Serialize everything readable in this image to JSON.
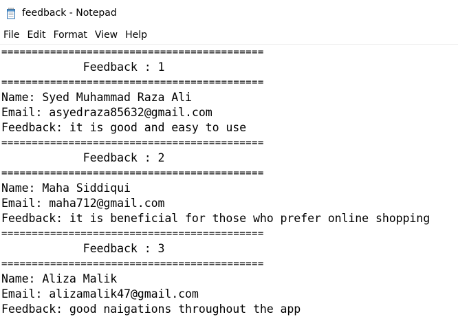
{
  "window": {
    "title": "feedback - Notepad",
    "icon": "notepad-icon"
  },
  "menu": [
    "File",
    "Edit",
    "Format",
    "View",
    "Help"
  ],
  "separator": "===========================================",
  "lines": [
    {
      "type": "sep"
    },
    {
      "type": "text",
      "text": "            Feedback : 1"
    },
    {
      "type": "sep"
    },
    {
      "type": "text",
      "text": "Name: Syed Muhammad Raza Ali"
    },
    {
      "type": "text",
      "text": "Email: asyedraza85632@gmail.com"
    },
    {
      "type": "text",
      "text": "Feedback: it is good and easy to use"
    },
    {
      "type": "sep"
    },
    {
      "type": "text",
      "text": "            Feedback : 2"
    },
    {
      "type": "sep"
    },
    {
      "type": "text",
      "text": "Name: Maha Siddiqui"
    },
    {
      "type": "text",
      "text": "Email: maha712@gmail.com"
    },
    {
      "type": "text",
      "text": "Feedback: it is beneficial for those who prefer online shopping"
    },
    {
      "type": "sep"
    },
    {
      "type": "text",
      "text": "            Feedback : 3"
    },
    {
      "type": "sep"
    },
    {
      "type": "text",
      "text": "Name: Aliza Malik"
    },
    {
      "type": "text",
      "text": "Email: alizamalik47@gmail.com"
    },
    {
      "type": "text",
      "text": "Feedback: good naigations throughout the app"
    }
  ]
}
